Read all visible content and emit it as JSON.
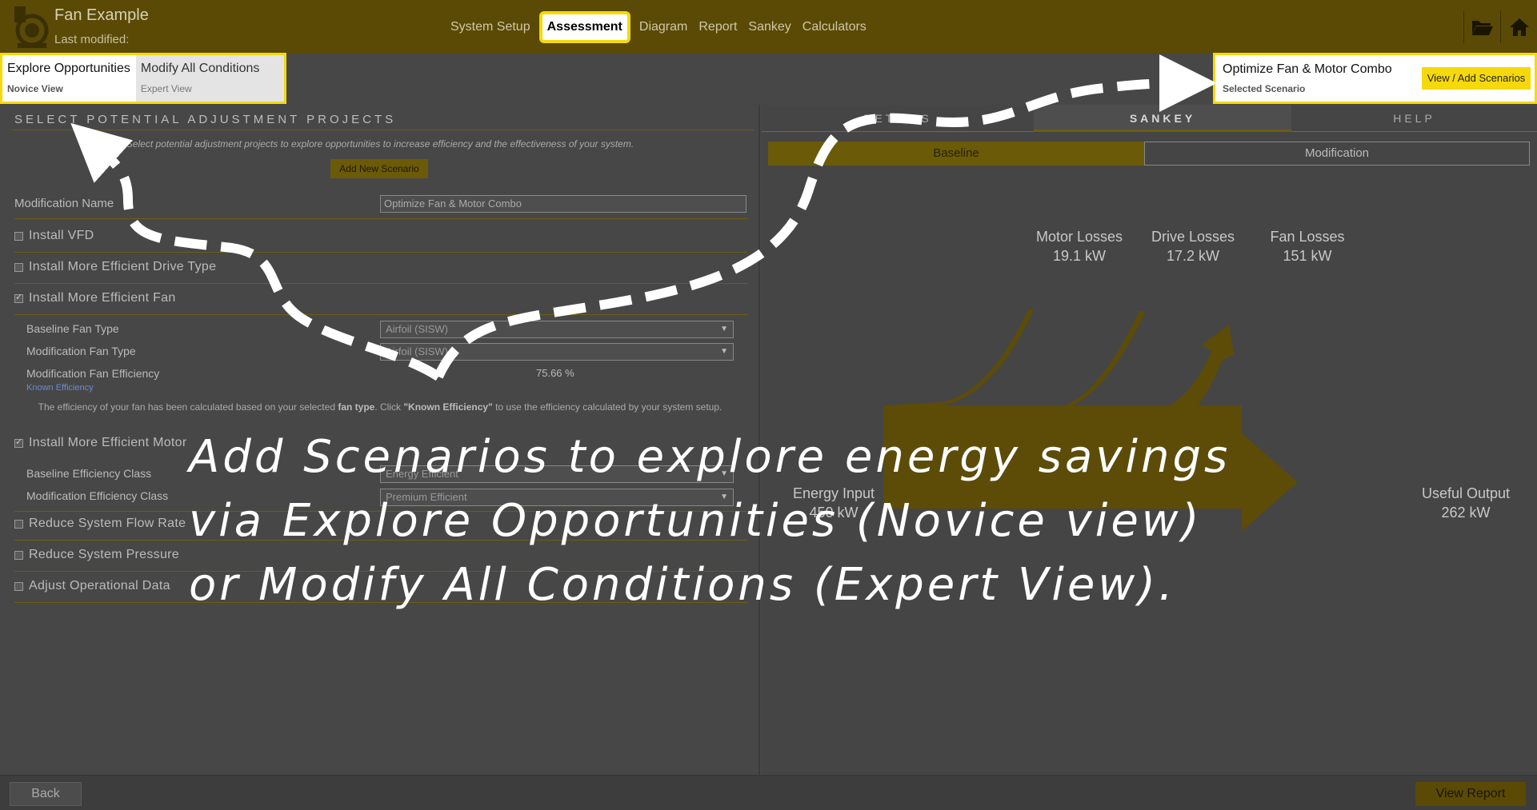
{
  "app": {
    "title": "Fan Example",
    "subtitle": "Last modified:"
  },
  "nav": {
    "tabs": [
      {
        "label": "System Setup"
      },
      {
        "label": "Assessment"
      },
      {
        "label": "Diagram"
      },
      {
        "label": "Report"
      },
      {
        "label": "Sankey"
      },
      {
        "label": "Calculators"
      }
    ],
    "active": "Assessment",
    "icons": [
      "folder-open-icon",
      "home-icon"
    ]
  },
  "views": {
    "novice": {
      "title": "Explore Opportunities",
      "sub": "Novice View"
    },
    "expert": {
      "title": "Modify All Conditions",
      "sub": "Expert View"
    }
  },
  "scenario": {
    "name": "Optimize Fan & Motor Combo",
    "sub": "Selected Scenario",
    "button": "View / Add Scenarios"
  },
  "left": {
    "header": "SELECT POTENTIAL ADJUSTMENT PROJECTS",
    "intro": "Select potential adjustment projects to explore opportunities to increase efficiency and the effectiveness of your system.",
    "add_button": "Add New Scenario",
    "mod_name_label": "Modification Name",
    "mod_name_value": "Optimize Fan & Motor Combo",
    "install_vfd": "Install VFD",
    "install_drive": "Install More Efficient Drive Type",
    "install_fan": "Install More Efficient Fan",
    "baseline_fan_type_label": "Baseline Fan Type",
    "baseline_fan_type_value": "Airfoil (SISW)",
    "mod_fan_type_label": "Modification Fan Type",
    "mod_fan_type_value": "Airfoil (SISW)",
    "mod_fan_eff_label": "Modification Fan Efficiency",
    "mod_fan_eff_value": "75.66 %",
    "known_eff_link": "Known Efficiency",
    "note_part1": "The efficiency of your fan has been calculated based on your selected ",
    "note_bold1": "fan type",
    "note_part2": ". Click ",
    "note_bold2": "\"Known Efficiency\"",
    "note_part3": " to use the efficiency calculated by your system setup.",
    "install_motor": "Install More Efficient Motor",
    "baseline_eff_class_label": "Baseline Efficiency Class",
    "baseline_eff_class_value": "Energy Efficient",
    "mod_eff_class_label": "Modification Efficiency Class",
    "mod_eff_class_value": "Premium Efficient",
    "reduce_flow": "Reduce System Flow Rate",
    "reduce_pressure": "Reduce System Pressure",
    "adjust_op": "Adjust Operational Data"
  },
  "right": {
    "tabs": {
      "left": "DETAILS",
      "sankey": "SANKEY",
      "help": "HELP"
    },
    "toggle": {
      "baseline": "Baseline",
      "modification": "Modification"
    },
    "sankey": {
      "motor_losses": {
        "label": "Motor Losses",
        "value": "19.1 kW"
      },
      "drive_losses": {
        "label": "Drive Losses",
        "value": "17.2 kW"
      },
      "fan_losses": {
        "label": "Fan Losses",
        "value": "151 kW"
      },
      "energy_input": {
        "label": "Energy Input",
        "value": "450 kW"
      },
      "useful_output": {
        "label": "Useful Output",
        "value": "262 kW"
      }
    }
  },
  "footer": {
    "back": "Back",
    "view_report": "View Report"
  },
  "annotation": {
    "line1": "Add Scenarios to explore energy savings",
    "line2": "via Explore Opportunities (Novice view)",
    "line3": "or Modify All Conditions (Expert View)."
  },
  "colors": {
    "accent_yellow": "#f5d90a",
    "dim_gold": "#5a4a05",
    "overlay_gray": "#474747"
  }
}
